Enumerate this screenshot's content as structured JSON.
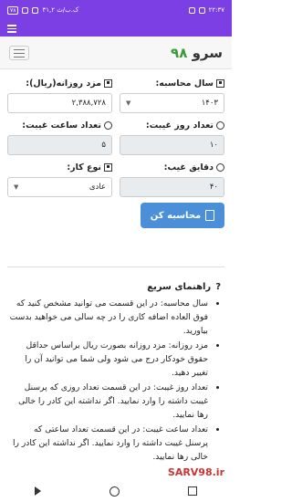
{
  "status": {
    "time": "۲۲:۳۷",
    "speed": "۳۱,۲ ک.ب/ث",
    "battery": "۷۸"
  },
  "brand": {
    "name": "سرو",
    "num": "۹۸"
  },
  "form": {
    "year_label": "سال محاسبه:",
    "year_value": "۱۴۰۳",
    "wage_label": "مزد روزانه(ریال):",
    "wage_value": "۲,۳۸۸,۷۲۸",
    "days_label": "تعداد روز غیبت:",
    "days_value": "۱۰",
    "hours_label": "تعداد ساعت غیبت:",
    "hours_value": "۵",
    "minutes_label": "دقایق غیب:",
    "minutes_value": "۴۰",
    "type_label": "نوع کار:",
    "type_value": "عادی",
    "calc_label": "محاسبه کن"
  },
  "guide": {
    "title": "راهنمای سریع",
    "items": [
      "سال محاسبه: در این قسمت می توانید مشخص کنید که فوق العاده اضافه کاری را در چه سالی می خواهید بدست بیاورید.",
      "مزد روزانه: مزد روزانه بصورت ریال براساس حداقل حقوق خودکار درج می شود ولی شما می توانید آن را تغییر دهید.",
      "تعداد روز غیبت: در این قسمت تعداد روزی که پرسنل غیبت داشته را وارد نمایید. اگر نداشته این کادر را خالی رها نمایید.",
      "تعداد ساعت غیبت: در این قسمت تعداد ساعتی که پرسنل غیبت داشته را وارد نمایید. اگر نداشته این کادر را خالی رها نمایید."
    ]
  },
  "watermark": "SARV98.ir"
}
